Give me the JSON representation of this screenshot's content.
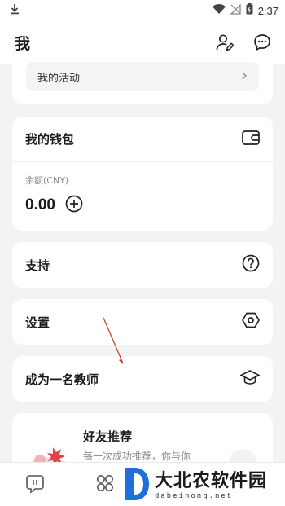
{
  "status_bar": {
    "time": "2:37",
    "icons": [
      "download-icon",
      "wifi-icon",
      "no-signal-icon",
      "battery-icon"
    ]
  },
  "header": {
    "title": "我",
    "icons": [
      "profile-edit-icon",
      "message-icon"
    ]
  },
  "activity": {
    "label": "我的活动"
  },
  "wallet": {
    "title": "我的钱包",
    "balance_label": "余额(CNY)",
    "balance_value": "0.00"
  },
  "menu": {
    "support": "支持",
    "settings": "设置",
    "become_teacher": "成为一名教师"
  },
  "referral": {
    "title": "好友推荐",
    "description": "每一次成功推荐，你与你"
  },
  "tab_bar": {
    "icons": [
      "chat-tab-icon",
      "apps-tab-icon"
    ]
  },
  "watermark": {
    "text": "大北农软件园",
    "domain": "dabeinong.net"
  },
  "colors": {
    "background": "#f2f3f5",
    "card": "#ffffff",
    "annotation_arrow": "#c0392b",
    "watermark_logo": "#1e6fd9"
  }
}
